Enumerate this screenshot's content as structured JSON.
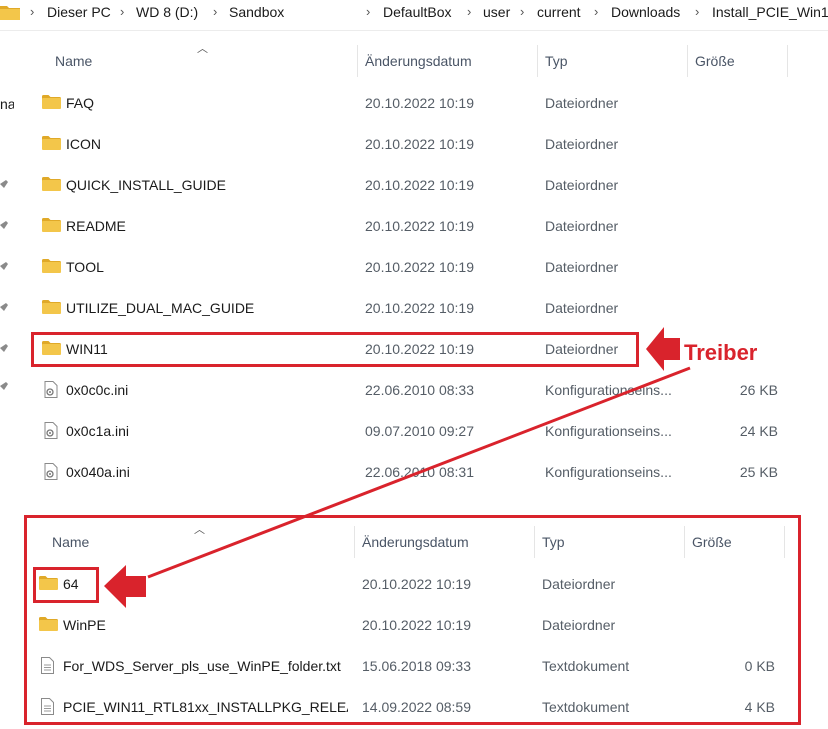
{
  "breadcrumb": [
    "Dieser PC",
    "WD 8 (D:)",
    "Sandbox",
    "DefaultBox",
    "user",
    "current",
    "Downloads",
    "Install_PCIE_Win1"
  ],
  "columns": {
    "name": "Name",
    "date": "Änderungsdatum",
    "type": "Typ",
    "size": "Größe"
  },
  "top_rows": [
    {
      "icon": "folder-icon",
      "name": "FAQ",
      "date": "20.10.2022 10:19",
      "type": "Dateiordner",
      "size": ""
    },
    {
      "icon": "folder-icon",
      "name": "ICON",
      "date": "20.10.2022 10:19",
      "type": "Dateiordner",
      "size": ""
    },
    {
      "icon": "folder-icon",
      "name": "QUICK_INSTALL_GUIDE",
      "date": "20.10.2022 10:19",
      "type": "Dateiordner",
      "size": ""
    },
    {
      "icon": "folder-icon",
      "name": "README",
      "date": "20.10.2022 10:19",
      "type": "Dateiordner",
      "size": ""
    },
    {
      "icon": "folder-icon",
      "name": "TOOL",
      "date": "20.10.2022 10:19",
      "type": "Dateiordner",
      "size": ""
    },
    {
      "icon": "folder-icon",
      "name": "UTILIZE_DUAL_MAC_GUIDE",
      "date": "20.10.2022 10:19",
      "type": "Dateiordner",
      "size": ""
    },
    {
      "icon": "folder-icon",
      "name": "WIN11",
      "date": "20.10.2022 10:19",
      "type": "Dateiordner",
      "size": ""
    },
    {
      "icon": "ini-file-icon",
      "name": "0x0c0c.ini",
      "date": "22.06.2010 08:33",
      "type": "Konfigurationseins...",
      "size": "26 KB"
    },
    {
      "icon": "ini-file-icon",
      "name": "0x0c1a.ini",
      "date": "09.07.2010 09:27",
      "type": "Konfigurationseins...",
      "size": "24 KB"
    },
    {
      "icon": "ini-file-icon",
      "name": "0x040a.ini",
      "date": "22.06.2010 08:31",
      "type": "Konfigurationseins...",
      "size": "25 KB"
    }
  ],
  "bottom_rows": [
    {
      "icon": "folder-icon",
      "name": "64",
      "date": "20.10.2022 10:19",
      "type": "Dateiordner",
      "size": ""
    },
    {
      "icon": "folder-icon",
      "name": "WinPE",
      "date": "20.10.2022 10:19",
      "type": "Dateiordner",
      "size": ""
    },
    {
      "icon": "text-file-icon",
      "name": "For_WDS_Server_pls_use_WinPE_folder.txt",
      "date": "15.06.2018 09:33",
      "type": "Textdokument",
      "size": "0 KB"
    },
    {
      "icon": "text-file-icon",
      "name": "PCIE_WIN11_RTL81xx_INSTALLPKG_RELEA...",
      "date": "14.09.2022 08:59",
      "type": "Textdokument",
      "size": "4 KB"
    }
  ],
  "sidebar_fragment": "na",
  "annotation": {
    "label": "Treiber",
    "color": "#d9232c"
  },
  "colors": {
    "folder": "#f3c64a",
    "folder_dark": "#e0a928",
    "highlight": "#d9232c"
  }
}
